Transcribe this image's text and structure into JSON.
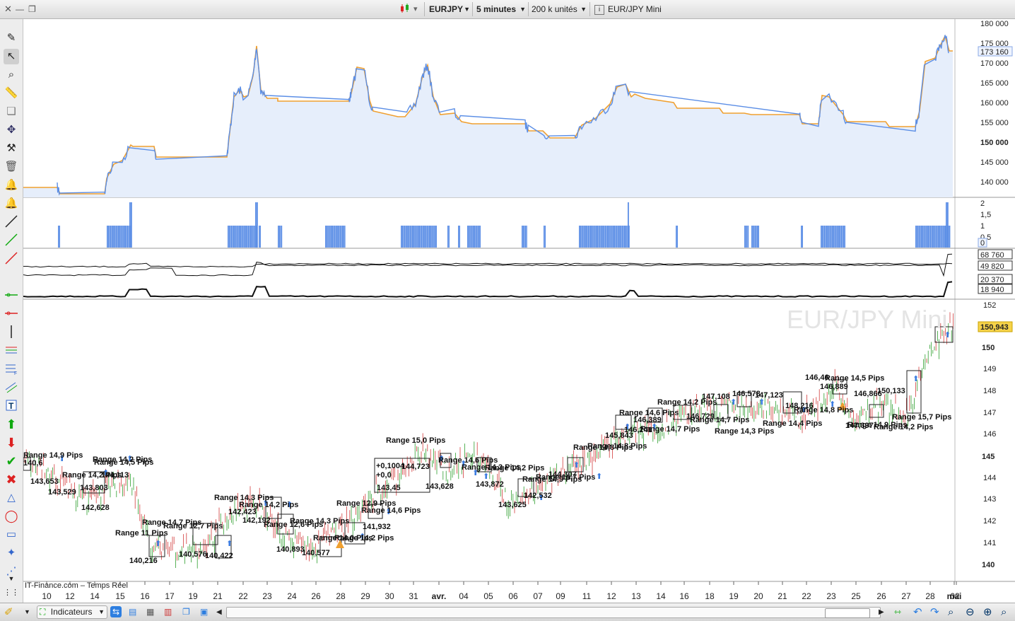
{
  "topbar": {
    "symbol": "EURJPY",
    "timeframe": "5 minutes",
    "units": "200 k unités",
    "info_title": "EUR/JPY Mini"
  },
  "panel_price": {
    "y_ticks": [
      "180 000",
      "175 000",
      "170 000",
      "165 000",
      "160 000",
      "155 000",
      "150 000",
      "145 000",
      "140 000"
    ],
    "last_value": "173 160"
  },
  "panel_bars": {
    "y_ticks": [
      "2",
      "1,5",
      "1",
      "0,5"
    ],
    "last_value": "0"
  },
  "panel_lines": {
    "tag_values": [
      "68 760",
      "49 820",
      "20 370",
      "18 940"
    ]
  },
  "panel_main": {
    "watermark": "EUR/JPY Mini",
    "y_ticks": [
      "152",
      "150",
      "149",
      "148",
      "147",
      "146",
      "145",
      "144",
      "143",
      "142",
      "141",
      "140"
    ],
    "last_value": "150,943",
    "source_label": "IT-Finance.com – Temps Réel",
    "labels": [
      {
        "t": "Range 14,9 Pips"
      },
      {
        "t": "143,653"
      },
      {
        "t": "140,6"
      },
      {
        "t": "Range 14,2 Pips"
      },
      {
        "t": "143,529"
      },
      {
        "t": "143,803"
      },
      {
        "t": "142,628"
      },
      {
        "t": "Range 14,2 Pips"
      },
      {
        "t": "144,113"
      },
      {
        "t": "Range 14,5 Pips"
      },
      {
        "t": "140,216"
      },
      {
        "t": "Range 11 Pips"
      },
      {
        "t": "Range 14,7 Pips"
      },
      {
        "t": "Range 12,7 Pips"
      },
      {
        "t": "140,576"
      },
      {
        "t": "140,422"
      },
      {
        "t": "Range 14,3 Pips"
      },
      {
        "t": "Range 14,2 Pips"
      },
      {
        "t": "142,423"
      },
      {
        "t": "142,192"
      },
      {
        "t": "Range 12,6 Pips"
      },
      {
        "t": "Range 14,3 Pips"
      },
      {
        "t": "140,893"
      },
      {
        "t": "140,577"
      },
      {
        "t": "Range 14,0 Pips"
      },
      {
        "t": "Range 14,2 Pips"
      },
      {
        "t": "Range 12,9 Pips"
      },
      {
        "t": "141,932"
      },
      {
        "t": "Range 14,6 Pips"
      },
      {
        "t": "143,45"
      },
      {
        "t": "Range 15,0 Pips"
      },
      {
        "t": "+0,1004"
      },
      {
        "t": "+0,0"
      },
      {
        "t": "144,723"
      },
      {
        "t": "143,628"
      },
      {
        "t": "Range 14,6 Pips"
      },
      {
        "t": "Range 14,3 Pips"
      },
      {
        "t": "143,872"
      },
      {
        "t": "Range 14,2 Pips"
      },
      {
        "t": "143,625"
      },
      {
        "t": "Range 14,9 Pips"
      },
      {
        "t": "142,532"
      },
      {
        "t": "Range 14,7 Pips"
      },
      {
        "t": "144,307"
      },
      {
        "t": "Range 14,8 Pips"
      },
      {
        "t": "Range 14,8 Pips"
      },
      {
        "t": "145,843"
      },
      {
        "t": "Range 14,6 Pips"
      },
      {
        "t": "146,241"
      },
      {
        "t": "146,389"
      },
      {
        "t": "Range 14,7 Pips"
      },
      {
        "t": "Range 14,2 Pips"
      },
      {
        "t": "146,729"
      },
      {
        "t": "Range 14,7 Pips"
      },
      {
        "t": "147,108"
      },
      {
        "t": "Range 14,3 Pips"
      },
      {
        "t": "146,578"
      },
      {
        "t": "147,123"
      },
      {
        "t": "Range 14,4 Pips"
      },
      {
        "t": "148,216"
      },
      {
        "t": "Range 14,8 Pips"
      },
      {
        "t": "146,46"
      },
      {
        "t": "146,889"
      },
      {
        "t": "Range 14,5 Pips"
      },
      {
        "t": "147,397"
      },
      {
        "t": "Range 14,9 Pips"
      },
      {
        "t": "146,866"
      },
      {
        "t": "Range 14,2 Pips"
      },
      {
        "t": "150,133"
      },
      {
        "t": "Range 15,7 Pips"
      }
    ]
  },
  "x_axis": [
    "10",
    "12",
    "14",
    "15",
    "16",
    "17",
    "19",
    "21",
    "22",
    "23",
    "24",
    "26",
    "28",
    "29",
    "30",
    "31",
    "avr.",
    "04",
    "05",
    "06",
    "07",
    "09",
    "11",
    "12",
    "13",
    "14",
    "16",
    "18",
    "19",
    "20",
    "21",
    "22",
    "23",
    "25",
    "26",
    "27",
    "28",
    "mai",
    "02"
  ],
  "bottombar": {
    "indicators_label": "Indicateurs"
  }
}
